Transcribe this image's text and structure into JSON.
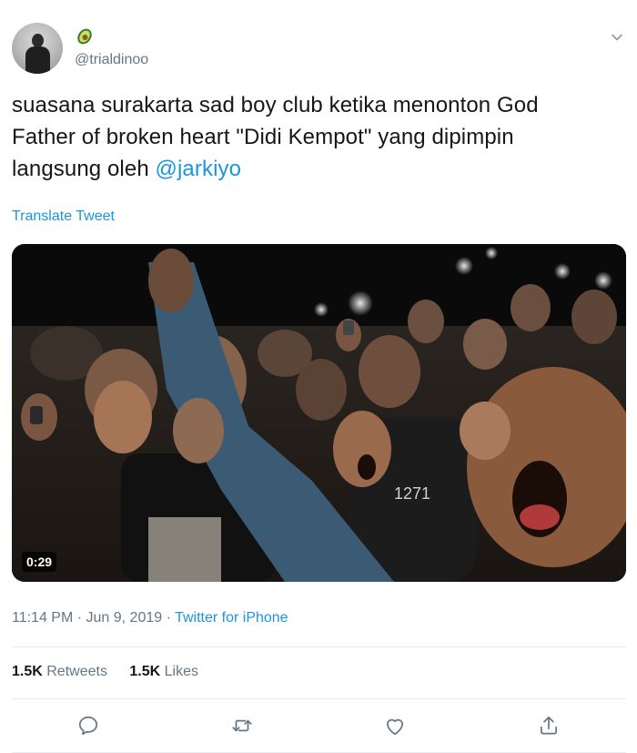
{
  "user": {
    "emoji": "🥑",
    "handle": "@trialdinoo"
  },
  "tweet": {
    "text_line1": "suasana surakarta sad boy club ketika menonton God",
    "text_line2": "Father of broken heart \"Didi Kempot\" yang dipimpin",
    "text_line3_prefix": "langsung oleh ",
    "mention": "@jarkiyo",
    "translate_label": "Translate Tweet"
  },
  "media": {
    "duration": "0:29"
  },
  "meta": {
    "time": "11:14 PM",
    "separator1": " · ",
    "date": "Jun 9, 2019",
    "separator2": " · ",
    "source": "Twitter for iPhone"
  },
  "stats": {
    "retweets_count": "1.5K",
    "retweets_label": "Retweets",
    "likes_count": "1.5K",
    "likes_label": "Likes"
  },
  "colors": {
    "link": "#1b95e0",
    "secondary": "#657786",
    "text": "#14171a",
    "divider": "#e6ecf0"
  },
  "icons": {
    "reply": "reply-icon",
    "retweet": "retweet-icon",
    "like": "like-icon",
    "share": "share-icon",
    "menu": "chevron-down-icon"
  }
}
